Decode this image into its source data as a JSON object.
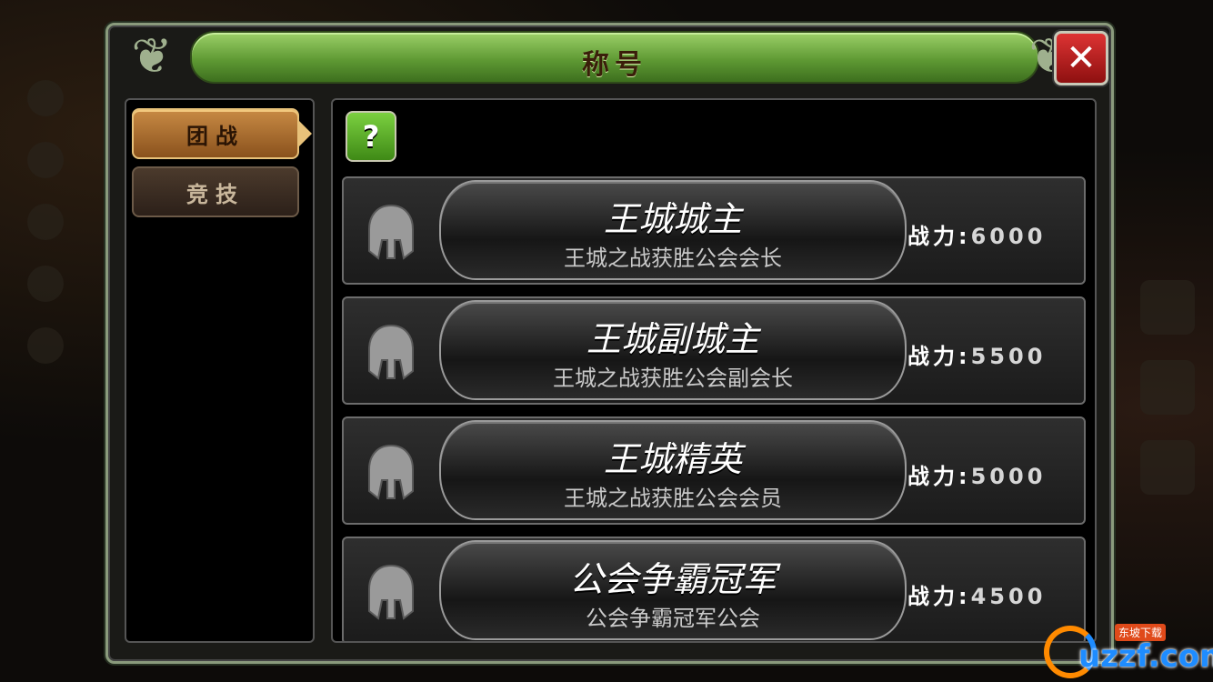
{
  "window": {
    "title": "称号",
    "close_icon": "close-icon"
  },
  "sidebar": {
    "tabs": [
      {
        "label": "团战",
        "active": true
      },
      {
        "label": "竞技",
        "active": false
      }
    ]
  },
  "content": {
    "help_label": "?",
    "titles": [
      {
        "name": "王城城主",
        "desc": "王城之战获胜公会会长",
        "power_label": "战力:",
        "power": "6000",
        "icon": "helmet-icon"
      },
      {
        "name": "王城副城主",
        "desc": "王城之战获胜公会副会长",
        "power_label": "战力:",
        "power": "5500",
        "icon": "helmet-icon"
      },
      {
        "name": "王城精英",
        "desc": "王城之战获胜公会会员",
        "power_label": "战力:",
        "power": "5000",
        "icon": "helmet-icon"
      },
      {
        "name": "公会争霸冠军",
        "desc": "公会争霸冠军公会",
        "power_label": "战力:",
        "power": "4500",
        "icon": "helmet-icon"
      }
    ]
  },
  "watermark": {
    "text": "uzzf.com",
    "sub": "东坡下载"
  },
  "colors": {
    "title_bar": "#6fae3e",
    "active_tab": "#b57a36",
    "help_button": "#5db22b",
    "close_button": "#c21e1e"
  }
}
